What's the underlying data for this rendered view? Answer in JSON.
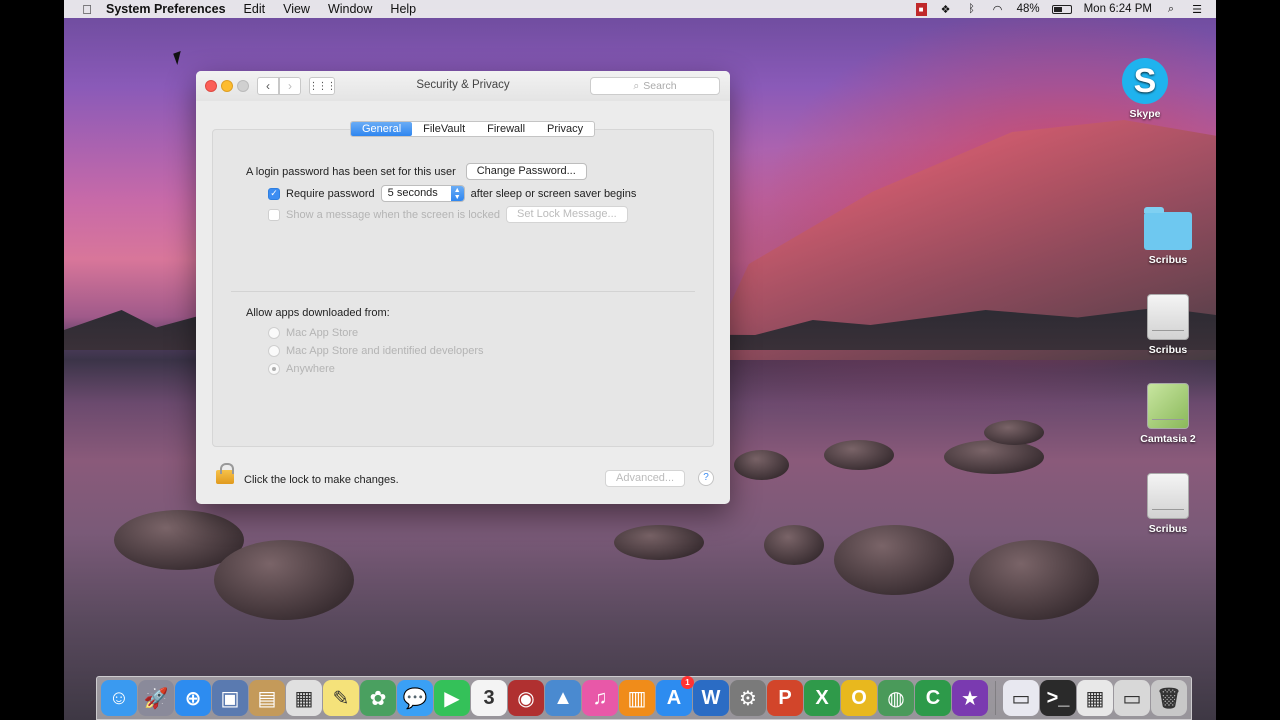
{
  "menubar": {
    "app_name": "System Preferences",
    "menus": [
      "Edit",
      "View",
      "Window",
      "Help"
    ],
    "battery": "48%",
    "clock": "Mon 6:24 PM"
  },
  "desktop_icons": [
    {
      "label": "Skype"
    },
    {
      "label": "Scribus"
    },
    {
      "label": "Scribus"
    },
    {
      "label": "Camtasia 2"
    },
    {
      "label": "Scribus"
    }
  ],
  "window": {
    "title": "Security & Privacy",
    "search_placeholder": "Search",
    "tabs": [
      "General",
      "FileVault",
      "Firewall",
      "Privacy"
    ],
    "active_tab": "General",
    "login_text": "A login password has been set for this user",
    "change_password_button": "Change Password...",
    "require_password_label": "Require password",
    "require_password_checked": true,
    "require_password_delay": "5 seconds",
    "after_sleep_text": "after sleep or screen saver begins",
    "show_message_label": "Show a message when the screen is locked",
    "set_lock_message_button": "Set Lock Message...",
    "allow_apps_label": "Allow apps downloaded from:",
    "allow_options": [
      "Mac App Store",
      "Mac App Store and identified developers",
      "Anywhere"
    ],
    "allow_selected": "Anywhere",
    "lock_text": "Click the lock to make changes.",
    "advanced_button": "Advanced...",
    "help_button": "?"
  },
  "dock": {
    "apps": [
      {
        "icon": "finder-icon",
        "glyph": "☺",
        "color": "#3a9af0"
      },
      {
        "icon": "launchpad-icon",
        "glyph": "🚀",
        "color": "#8a8a9a"
      },
      {
        "icon": "safari-icon",
        "glyph": "⊕",
        "color": "#2d8cf0"
      },
      {
        "icon": "preview-icon",
        "glyph": "▣",
        "color": "#5a7ab0"
      },
      {
        "icon": "contacts-icon",
        "glyph": "▤",
        "color": "#c49a5a"
      },
      {
        "icon": "calendar-photos-icon",
        "glyph": "▦",
        "color": "#e0e0e0"
      },
      {
        "icon": "notes-icon",
        "glyph": "✎",
        "color": "#f5e27a"
      },
      {
        "icon": "photos-icon",
        "glyph": "✿",
        "color": "#4aa060"
      },
      {
        "icon": "messages-icon",
        "glyph": "💬",
        "color": "#3aa0f5"
      },
      {
        "icon": "facetime-icon",
        "glyph": "▶",
        "color": "#34c159"
      },
      {
        "icon": "calendar-icon",
        "glyph": "3",
        "color": "#f4f4f4"
      },
      {
        "icon": "photo-booth-icon",
        "glyph": "◉",
        "color": "#b03030"
      },
      {
        "icon": "keynote-icon",
        "glyph": "▲",
        "color": "#4a8ad0"
      },
      {
        "icon": "itunes-icon",
        "glyph": "♫",
        "color": "#e858a8"
      },
      {
        "icon": "ibooks-icon",
        "glyph": "▥",
        "color": "#f08c1a"
      },
      {
        "icon": "app-store-icon",
        "glyph": "A",
        "color": "#2d8cf0",
        "badge": "1"
      },
      {
        "icon": "word-icon",
        "glyph": "W",
        "color": "#2b6cc4"
      },
      {
        "icon": "system-preferences-icon",
        "glyph": "⚙",
        "color": "#7a7a7a"
      },
      {
        "icon": "powerpoint-icon",
        "glyph": "P",
        "color": "#d2452a"
      },
      {
        "icon": "excel-icon",
        "glyph": "X",
        "color": "#2f9a4a"
      },
      {
        "icon": "outlook-icon",
        "glyph": "O",
        "color": "#e8b81e"
      },
      {
        "icon": "transmission-icon",
        "glyph": "◍",
        "color": "#4a9a5a"
      },
      {
        "icon": "camtasia-icon",
        "glyph": "C",
        "color": "#2d9a4a"
      },
      {
        "icon": "imovie-icon",
        "glyph": "★",
        "color": "#7a3ab0"
      }
    ],
    "trailing": [
      {
        "icon": "documents-stack-icon",
        "glyph": "▭",
        "color": "#e8e8f0"
      },
      {
        "icon": "terminal-icon",
        "glyph": ">_",
        "color": "#2a2a2a"
      },
      {
        "icon": "grid-stack-icon",
        "glyph": "▦",
        "color": "#e8e8e8"
      },
      {
        "icon": "downloads-stack-icon",
        "glyph": "▭",
        "color": "#d8d8d8"
      },
      {
        "icon": "trash-icon",
        "glyph": "🗑",
        "color": "#c8c8c8"
      }
    ]
  }
}
